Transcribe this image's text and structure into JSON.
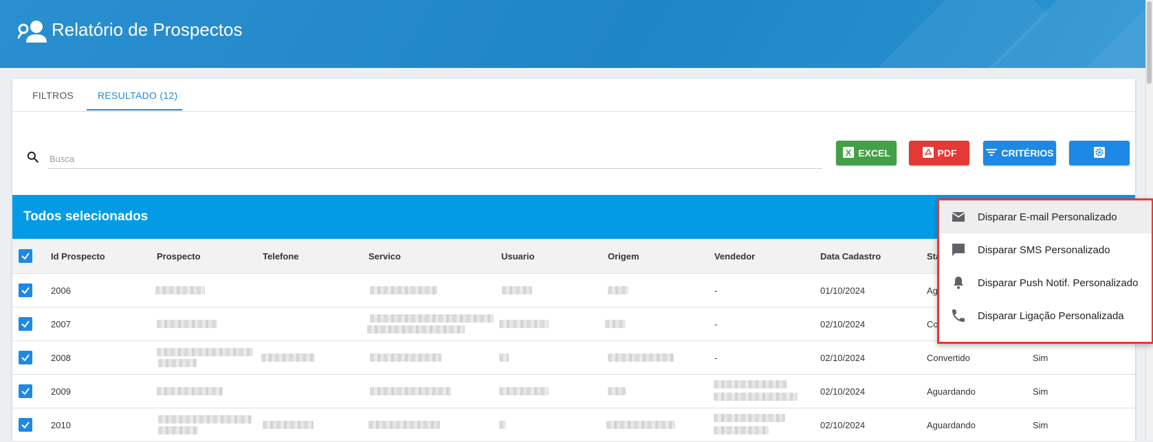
{
  "header": {
    "title": "Relatório de Prospectos",
    "icon": "user-key-icon"
  },
  "tabs": [
    {
      "label": "FILTROS",
      "active": false
    },
    {
      "label": "RESULTADO (12)",
      "active": true
    }
  ],
  "search": {
    "placeholder": "Busca",
    "value": ""
  },
  "toolbar": {
    "excel_label": "EXCEL",
    "pdf_label": "PDF",
    "criteria_label": "CRITÉRIOS",
    "excel_color": "#43a047",
    "pdf_color": "#e53935",
    "primary_color": "#1e88e5"
  },
  "banner": {
    "text": "Todos selecionados",
    "color": "#039be5"
  },
  "table": {
    "columns": [
      "Id Prospecto",
      "Prospecto",
      "Telefone",
      "Servico",
      "Usuario",
      "Origem",
      "Vendedor",
      "Data Cadastro",
      "Sta"
    ],
    "rows": [
      {
        "id": "2006",
        "vendedor": "-",
        "data": "01/10/2024",
        "status": "Ag",
        "extra": ""
      },
      {
        "id": "2007",
        "vendedor": "-",
        "data": "02/10/2024",
        "status": "Co",
        "extra": ""
      },
      {
        "id": "2008",
        "vendedor": "-",
        "data": "02/10/2024",
        "status": "Convertido",
        "extra": "Sim"
      },
      {
        "id": "2009",
        "vendedor": "",
        "data": "02/10/2024",
        "status": "Aguardando",
        "extra": "Sim"
      },
      {
        "id": "2010",
        "vendedor": "",
        "data": "02/10/2024",
        "status": "Aguardando",
        "extra": "Sim"
      }
    ]
  },
  "dropdown": {
    "items": [
      {
        "label": "Disparar E-mail Personalizado",
        "icon": "email-icon"
      },
      {
        "label": "Disparar SMS Personalizado",
        "icon": "chat-icon"
      },
      {
        "label": "Disparar Push Notif. Personalizado",
        "icon": "bell-icon"
      },
      {
        "label": "Disparar Ligação Personalizada",
        "icon": "phone-icon"
      }
    ],
    "highlight_color": "#e53935"
  }
}
